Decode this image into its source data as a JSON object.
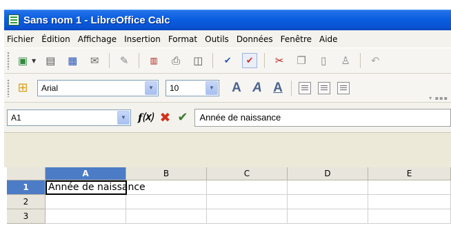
{
  "window": {
    "title": "Sans nom 1 - LibreOffice Calc"
  },
  "menubar": {
    "items": [
      "Fichier",
      "Édition",
      "Affichage",
      "Insertion",
      "Format",
      "Outils",
      "Données",
      "Fenêtre",
      "Aide"
    ]
  },
  "toolbar": {
    "icons": [
      "new-document-icon",
      "open-icon",
      "save-icon",
      "mail-icon",
      "edit-file-icon",
      "export-pdf-icon",
      "print-icon",
      "print-preview-icon",
      "spellcheck-icon",
      "autospellcheck-icon",
      "cut-icon",
      "copy-icon",
      "paste-icon",
      "clone-format-icon",
      "undo-icon"
    ]
  },
  "formatting": {
    "font_name": "Arial",
    "font_size": "10"
  },
  "formula_bar": {
    "name_box": "A1",
    "content": "Année de naissance"
  },
  "sheet": {
    "columns": [
      "A",
      "B",
      "C",
      "D",
      "E"
    ],
    "rows": [
      "1",
      "2",
      "3"
    ],
    "cells": {
      "A1": "Année de naissance"
    },
    "active_cell": "A1"
  }
}
